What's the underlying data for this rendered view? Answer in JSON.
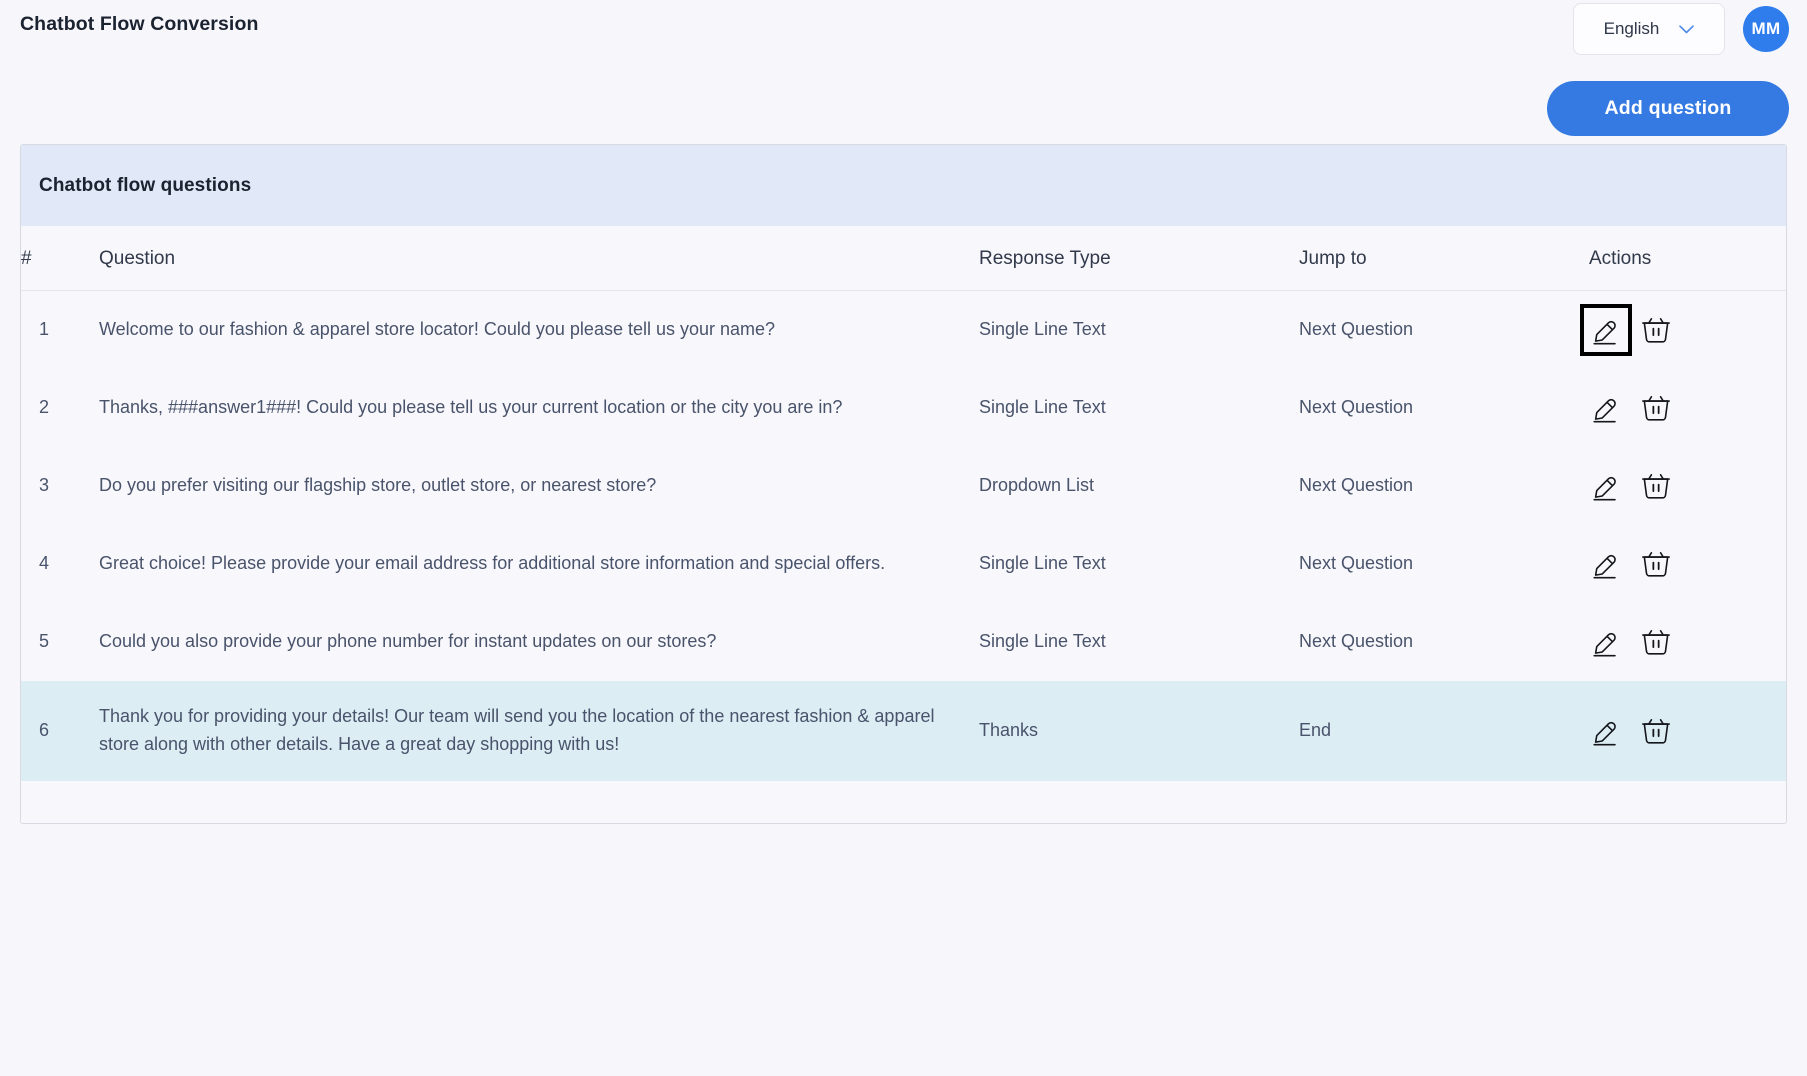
{
  "header": {
    "title": "Chatbot Flow Conversion",
    "language": {
      "selected": "English",
      "chevron_icon": "chevron-down-icon"
    },
    "avatar": {
      "initials": "MM",
      "color": "#2f7ded"
    }
  },
  "toolbar": {
    "add_question_label": "Add question",
    "add_question_color": "#347ae2"
  },
  "card": {
    "header_title": "Chatbot flow questions",
    "header_bg": "#e1e9f8",
    "highlight_row_bg": "#dcedf4"
  },
  "table": {
    "columns": [
      {
        "key": "num",
        "label": "#"
      },
      {
        "key": "q",
        "label": "Question"
      },
      {
        "key": "rt",
        "label": "Response Type"
      },
      {
        "key": "jt",
        "label": "Jump to"
      },
      {
        "key": "act",
        "label": "Actions"
      }
    ],
    "row_actions": {
      "edit_icon": "pencil-edit-icon",
      "delete_icon": "trash-basket-icon"
    },
    "rows": [
      {
        "num": "1",
        "question": "Welcome to our fashion & apparel store locator! Could you please tell us your name?",
        "response_type": "Single Line Text",
        "jump_to": "Next Question",
        "highlighted": false,
        "edit_focused": true
      },
      {
        "num": "2",
        "question": "Thanks, ###answer1###! Could you please tell us your current location or the city you are in?",
        "response_type": "Single Line Text",
        "jump_to": "Next Question",
        "highlighted": false,
        "edit_focused": false
      },
      {
        "num": "3",
        "question": "Do you prefer visiting our flagship store, outlet store, or nearest store?",
        "response_type": "Dropdown List",
        "jump_to": "Next Question",
        "highlighted": false,
        "edit_focused": false
      },
      {
        "num": "4",
        "question": "Great choice! Please provide your email address for additional store information and special offers.",
        "response_type": "Single Line Text",
        "jump_to": "Next Question",
        "highlighted": false,
        "edit_focused": false
      },
      {
        "num": "5",
        "question": "Could you also provide your phone number for instant updates on our stores?",
        "response_type": "Single Line Text",
        "jump_to": "Next Question",
        "highlighted": false,
        "edit_focused": false
      },
      {
        "num": "6",
        "question": "Thank you for providing your details! Our team will send you the location of the nearest fashion & apparel store along with other details. Have a great day shopping with us!",
        "response_type": "Thanks",
        "jump_to": "End",
        "highlighted": true,
        "edit_focused": false
      }
    ]
  }
}
